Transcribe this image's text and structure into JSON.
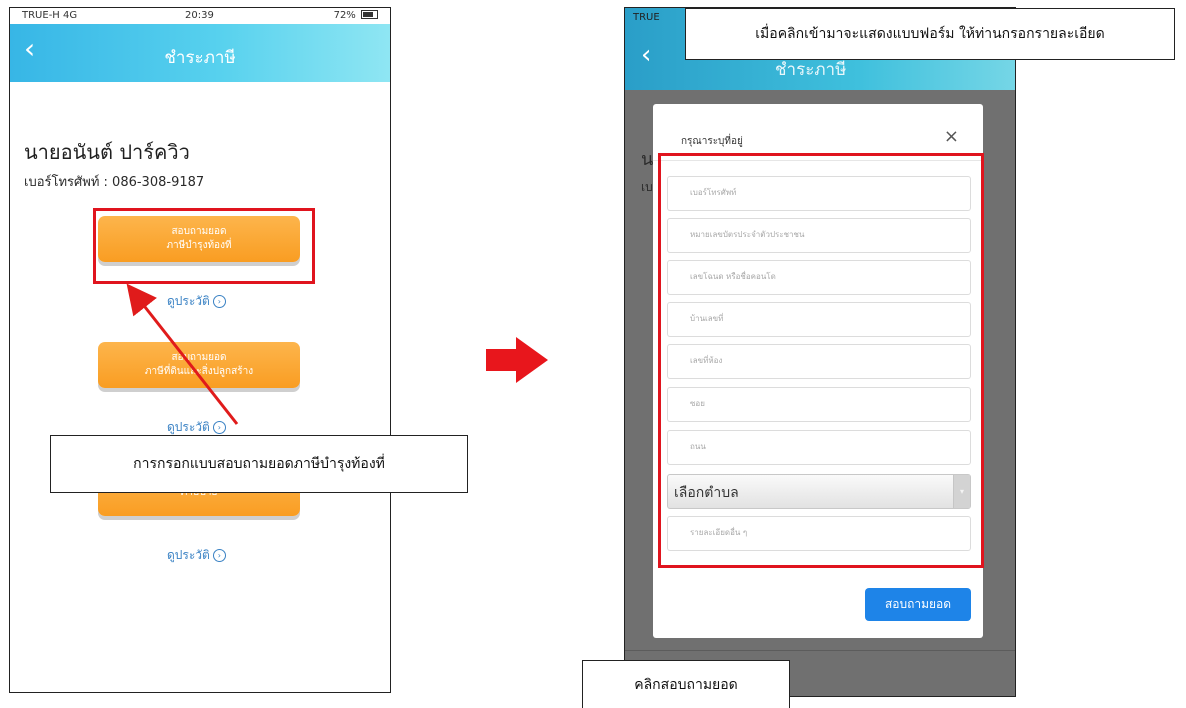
{
  "left_screen": {
    "status": {
      "carrier": "TRUE-H 4G",
      "time": "20:39",
      "battery": "72%"
    },
    "header_title": "ชำระภาษี",
    "user_name": "นายอนันต์ ปาร์ควิว",
    "phone_line": "เบอร์โทรศัพท์ : 086-308-9187",
    "buttons": [
      {
        "line1": "สอบถามยอด",
        "line2": "ภาษีบำรุงท้องที่",
        "history": "ดูประวัติ"
      },
      {
        "line1": "สอบถามยอด",
        "line2": "ภาษีที่ดินและสิ่งปลูกสร้าง",
        "history": "ดูประวัติ"
      },
      {
        "line1": "",
        "line2": "ภาษีป้าย",
        "history": "ดูประวัติ"
      }
    ]
  },
  "right_screen": {
    "status": {
      "carrier": "TRUE"
    },
    "header_title": "ชำระภาษี",
    "side_initial": "น",
    "side_initial2": "เบ",
    "modal": {
      "title": "กรุณาระบุที่อยู่",
      "close": "×",
      "fields": [
        "เบอร์โทรศัพท์",
        "หมายเลขบัตรประจำตัวประชาชน",
        "เลขโฉนด หรือชื่อคอนโด",
        "บ้านเลขที่",
        "เลขที่ห้อง",
        "ซอย",
        "ถนน"
      ],
      "select_label": "เลือกตำบล",
      "textarea_placeholder": "รายละเอียดอื่น ๆ",
      "submit_label": "สอบถามยอด"
    }
  },
  "callouts": {
    "left": "การกรอกแบบสอบถามยอดภาษีบำรุงท้องที่",
    "top_right": "เมื่อคลิกเข้ามาจะแสดงแบบฟอร์ม ให้ท่านกรอกรายละเอียด",
    "bottom_right": "คลิกสอบถามยอด"
  },
  "colors": {
    "accent_red": "#e0141e",
    "header_blue": "#37b6e6",
    "button_orange": "#f99d22",
    "submit_blue": "#1e84e8"
  }
}
